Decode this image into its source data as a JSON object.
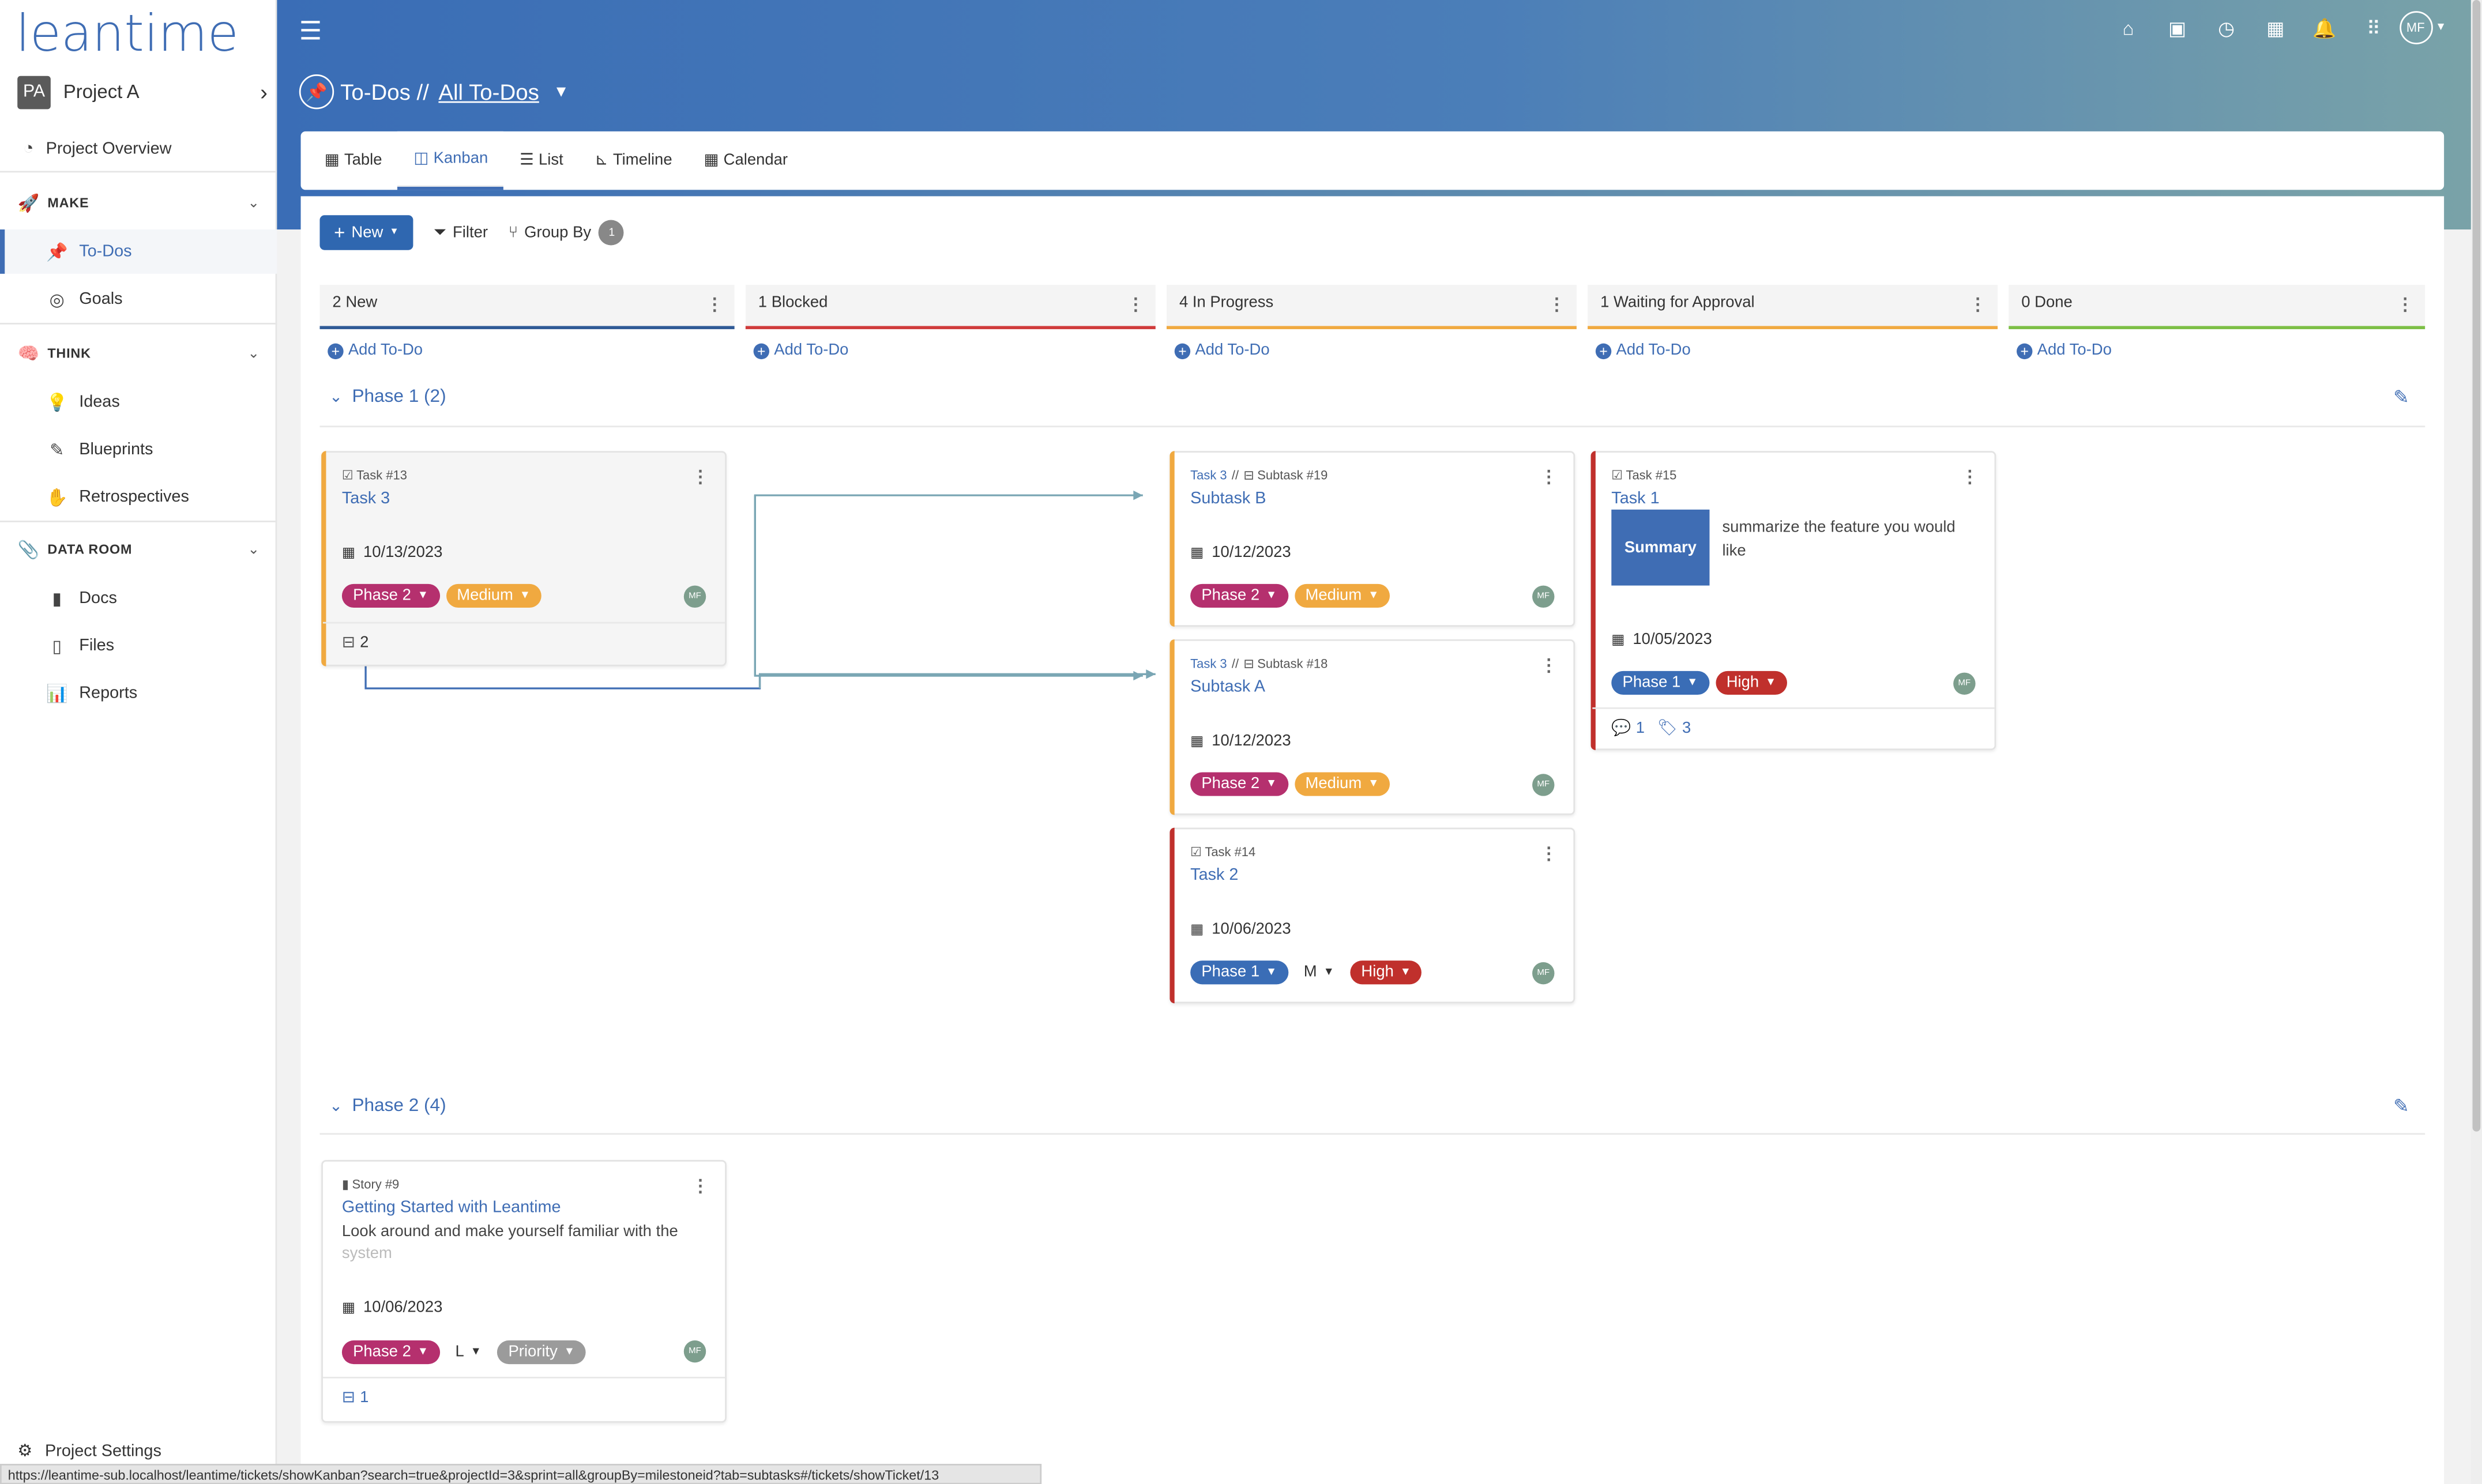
{
  "app": {
    "logo": "leantime"
  },
  "project": {
    "initials": "PA",
    "name": "Project A"
  },
  "sidebar": {
    "overview": "Project Overview",
    "make": "MAKE",
    "todos": "To-Dos",
    "goals": "Goals",
    "think": "THINK",
    "ideas": "Ideas",
    "blueprints": "Blueprints",
    "retrospectives": "Retrospectives",
    "data_room": "DATA ROOM",
    "docs": "Docs",
    "files": "Files",
    "reports": "Reports",
    "settings": "Project Settings"
  },
  "header": {
    "avatar": "MF",
    "crumb_prefix": "To-Dos //",
    "crumb_link": "All To-Dos"
  },
  "tabs": [
    "Table",
    "Kanban",
    "List",
    "Timeline",
    "Calendar"
  ],
  "toolbar": {
    "new": "New",
    "filter": "Filter",
    "group_by": "Group By",
    "group_count": "1"
  },
  "columns": [
    {
      "label": "2 New",
      "color": "#2f5a96"
    },
    {
      "label": "1 Blocked",
      "color": "#d03b3b"
    },
    {
      "label": "4 In Progress",
      "color": "#f0a940"
    },
    {
      "label": "1 Waiting for Approval",
      "color": "#f0a940"
    },
    {
      "label": "0 Done",
      "color": "#7cbf45"
    }
  ],
  "add_todo": "Add To-Do",
  "phases": [
    {
      "label": "Phase 1 (2)"
    },
    {
      "label": "Phase 2 (4)"
    }
  ],
  "cards": {
    "c13": {
      "type": "Task #13",
      "title": "Task 3",
      "date": "10/13/2023",
      "milestone": "Phase 2",
      "priority": "Medium",
      "av": "MF",
      "foot": "2"
    },
    "c19": {
      "parent": "Task 3",
      "sep": "//",
      "type": "Subtask #19",
      "title": "Subtask B",
      "date": "10/12/2023",
      "milestone": "Phase 2",
      "priority": "Medium",
      "av": "MF"
    },
    "c18": {
      "parent": "Task 3",
      "sep": "//",
      "type": "Subtask #18",
      "title": "Subtask A",
      "date": "10/12/2023",
      "milestone": "Phase 2",
      "priority": "Medium",
      "av": "MF"
    },
    "c14": {
      "type": "Task #14",
      "title": "Task 2",
      "date": "10/06/2023",
      "milestone": "Phase 1",
      "effort": "M",
      "priority": "High",
      "av": "MF"
    },
    "c15": {
      "type": "Task #15",
      "title": "Task 1",
      "summary": "Summary",
      "summary_text": "summarize the feature you would like",
      "date": "10/05/2023",
      "milestone": "Phase 1",
      "priority": "High",
      "av": "MF",
      "comments": "1",
      "subtasks": "3"
    },
    "c9": {
      "type": "Story #9",
      "title": "Getting Started with Leantime",
      "desc": "Look around and make yourself familiar with the",
      "desc_fade": "system",
      "date": "10/06/2023",
      "milestone": "Phase 2",
      "effort": "L",
      "priority": "Priority",
      "av": "MF",
      "foot": "1"
    }
  },
  "colors": {
    "phase2": "#b5306e",
    "phase1": "#3a6db6",
    "medium": "#f0a940",
    "high": "#c0302c",
    "gray": "#9b9b9b"
  },
  "statusbar": "https://leantime-sub.localhost/leantime/tickets/showKanban?search=true&projectId=3&sprint=all&groupBy=milestoneid?tab=subtasks#/tickets/showTicket/13"
}
